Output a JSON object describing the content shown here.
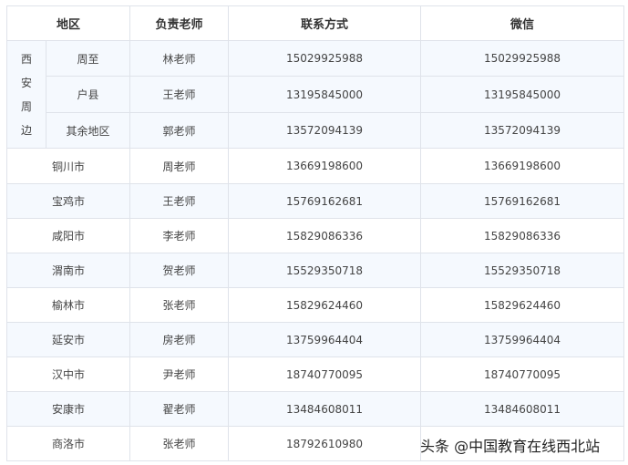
{
  "headers": [
    "地区",
    "负责老师",
    "联系方式",
    "微信"
  ],
  "group": {
    "label_chars": [
      "西",
      "安",
      "周",
      "边"
    ],
    "rows": [
      {
        "area": "周至",
        "teacher": "林老师",
        "phone": "15029925988",
        "wechat": "15029925988"
      },
      {
        "area": "户县",
        "teacher": "王老师",
        "phone": "13195845000",
        "wechat": "13195845000"
      },
      {
        "area": "其余地区",
        "teacher": "郭老师",
        "phone": "13572094139",
        "wechat": "13572094139"
      }
    ]
  },
  "rows": [
    {
      "area": "铜川市",
      "teacher": "周老师",
      "phone": "13669198600",
      "wechat": "13669198600"
    },
    {
      "area": "宝鸡市",
      "teacher": "王老师",
      "phone": "15769162681",
      "wechat": "15769162681"
    },
    {
      "area": "咸阳市",
      "teacher": "李老师",
      "phone": "15829086336",
      "wechat": "15829086336"
    },
    {
      "area": "渭南市",
      "teacher": "贺老师",
      "phone": "15529350718",
      "wechat": "15529350718"
    },
    {
      "area": "榆林市",
      "teacher": "张老师",
      "phone": "15829624460",
      "wechat": "15829624460"
    },
    {
      "area": "延安市",
      "teacher": "房老师",
      "phone": "13759964404",
      "wechat": "13759964404"
    },
    {
      "area": "汉中市",
      "teacher": "尹老师",
      "phone": "18740770095",
      "wechat": "18740770095"
    },
    {
      "area": "安康市",
      "teacher": "翟老师",
      "phone": "13484608011",
      "wechat": "13484608011"
    },
    {
      "area": "商洛市",
      "teacher": "张老师",
      "phone": "18792610980",
      "wechat": ""
    }
  ],
  "watermark": "头条 @中国教育在线西北站"
}
